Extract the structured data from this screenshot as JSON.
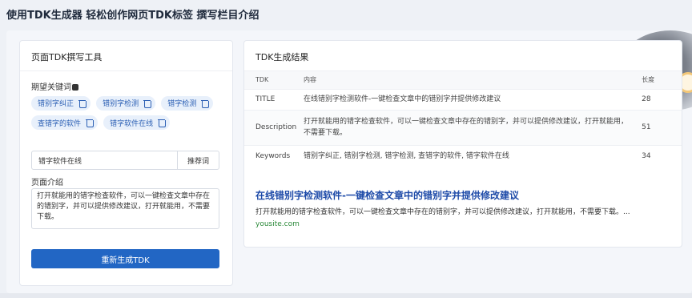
{
  "header": {
    "title": "使用TDK生成器 轻松创作网页TDK标签 撰写栏目介绍"
  },
  "left_panel": {
    "title": "页面TDK撰写工具",
    "keywords_label": "期望关键词",
    "tags": [
      "错别字纠正",
      "错别字检测",
      "错字检测",
      "查错字的软件",
      "错字软件在线"
    ],
    "keyword_input_value": "错字软件在线",
    "recommend_label": "推荐词",
    "intro_label": "页面介绍",
    "intro_value": "打开就能用的错字检查软件，可以一键检查文章中存在的错别字，并可以提供修改建议，打开就能用，不需要下载。",
    "regenerate_label": "重新生成TDK"
  },
  "right_panel": {
    "title": "TDK生成结果",
    "columns": [
      "TDK",
      "内容",
      "长度"
    ],
    "rows": [
      {
        "key": "TITLE",
        "content": "在线错别字检测软件-一键检查文章中的错别字并提供修改建议",
        "length": "28"
      },
      {
        "key": "Description",
        "content": "打开就能用的错字检查软件，可以一键检查文章中存在的错别字，并可以提供修改建议，打开就能用，不需要下载。",
        "length": "51"
      },
      {
        "key": "Keywords",
        "content": "错别字纠正, 错别字检测, 错字检测, 查错字的软件, 错字软件在线",
        "length": "34"
      }
    ],
    "preview": {
      "title": "在线错别字检测软件-一键检查文章中的错别字并提供修改建议",
      "description": "打开就能用的错字检查软件，可以一键检查文章中存在的错别字，并可以提供修改建议，打开就能用，不需要下载。...",
      "url": "yousite.com"
    }
  },
  "colors": {
    "accent": "#2266c4",
    "tag_bg": "#e8f0fb",
    "link": "#1d4aa8",
    "url": "#2c8a3a"
  }
}
